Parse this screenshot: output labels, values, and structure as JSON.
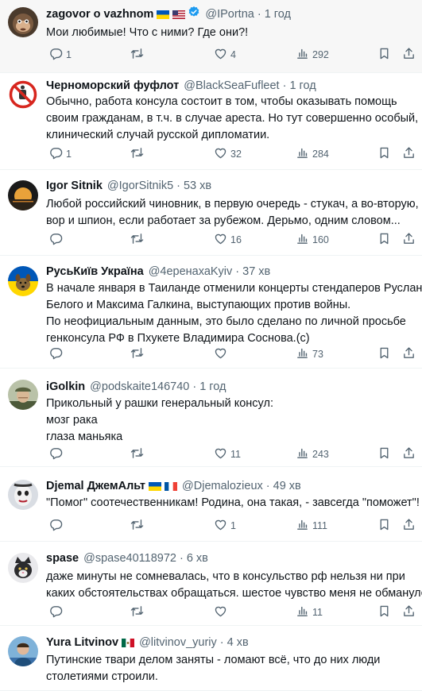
{
  "tweets": [
    {
      "name": "zagovor o vazhnom",
      "handle": "@IPortna",
      "time": "1 год",
      "flags": [
        "ukraine",
        "usa"
      ],
      "verified": true,
      "lines": [
        "Мои любимые! Что с ними? Где они?!"
      ],
      "replies": "1",
      "retweets": "",
      "likes": "4",
      "views": "292",
      "avatar_icon": "monkey-avatar-icon",
      "highlighted": true
    },
    {
      "name": "Черноморский фуфлот",
      "handle": "@BlackSeaFufleet",
      "time": "1 год",
      "flags": [],
      "verified": false,
      "lines": [
        "Обычно, работа консула состоит в том, чтобы оказывать помощь",
        "своим гражданам, в т.ч. в случае ареста. Но тут совершенно особый,",
        "клинический случай русской  дипломатии."
      ],
      "replies": "1",
      "retweets": "",
      "likes": "32",
      "views": "284",
      "avatar_icon": "prohibition-sign-icon"
    },
    {
      "name": "Igor Sitnik",
      "handle": "@IgorSitnik5",
      "time": "53 хв",
      "flags": [],
      "verified": false,
      "lines": [
        "Любой российский чиновник, в первую очередь - стукач, а во-вторую,",
        "вор и шпион, если работает за рубежом. Дерьмо, одним словом..."
      ],
      "replies": "",
      "retweets": "",
      "likes": "16",
      "views": "160",
      "avatar_icon": "sunset-avatar-icon"
    },
    {
      "name": "РусьКиїв Україна",
      "handle": "@4еренахаKyiv",
      "time": "37 хв",
      "flags": [],
      "verified": false,
      "lines": [
        "В начале января в Таиланде отменили концерты стендаперов Руслана",
        "Белого и Максима Галкина, выступающих против войны.",
        "По неофициальным данным, это было сделано по личной просьбе",
        "генконсула РФ в Пхукете Владимира Соснова.(с)"
      ],
      "replies": "",
      "retweets": "",
      "likes": "",
      "views": "73",
      "avatar_icon": "dog-ukraine-avatar-icon"
    },
    {
      "name": "iGolkin",
      "handle": "@podskaite146740",
      "time": "1 год",
      "flags": [],
      "verified": false,
      "lines": [
        "Прикольный у рашки генеральный консул:",
        "мозг рака",
        "глаза маньяка"
      ],
      "replies": "",
      "retweets": "",
      "likes": "11",
      "views": "243",
      "avatar_icon": "soldier-avatar-icon"
    },
    {
      "name": "Djemal ДжемАльт",
      "handle": "@Djemalozieux",
      "time": "49 хв",
      "flags": [
        "ukraine",
        "france"
      ],
      "verified": false,
      "lines": [
        "\"Помог\" соотечественникам! Родина, она такая, - завсегда \"поможет\"!"
      ],
      "replies": "",
      "retweets": "",
      "likes": "1",
      "views": "111",
      "avatar_icon": "painted-face-avatar-icon"
    },
    {
      "name": "spase",
      "handle": "@spase40118972",
      "time": "6 хв",
      "flags": [],
      "verified": false,
      "lines": [
        "даже минуты не сомневалась, что в консульство рф нельзя ни при",
        "каких обстоятельствах обращаться. шестое чувство меня не обмануло)"
      ],
      "replies": "",
      "retweets": "",
      "likes": "",
      "views": "11",
      "avatar_icon": "cat-avatar-icon"
    },
    {
      "name": "Yura Litvinov",
      "handle": "@litvinov_yuriy",
      "time": "4 хв",
      "flags": [
        "mexico"
      ],
      "verified": false,
      "lines": [
        "Путинские твари делом заняты - ломают всё, что до них люди",
        "столетиями строили."
      ],
      "replies": "",
      "retweets": "",
      "likes": "",
      "views": "",
      "avatar_icon": "person-avatar-icon"
    }
  ],
  "icons": {
    "reply": "reply-icon",
    "retweet": "retweet-icon",
    "like": "like-icon",
    "views": "views-icon",
    "bookmark": "bookmark-icon",
    "share": "share-icon"
  },
  "colors": {
    "text": "#0f1419",
    "muted": "#536471",
    "verified": "#1d9bf0",
    "divider": "#eff3f4",
    "highlight_bg": "#f7f7f7"
  }
}
